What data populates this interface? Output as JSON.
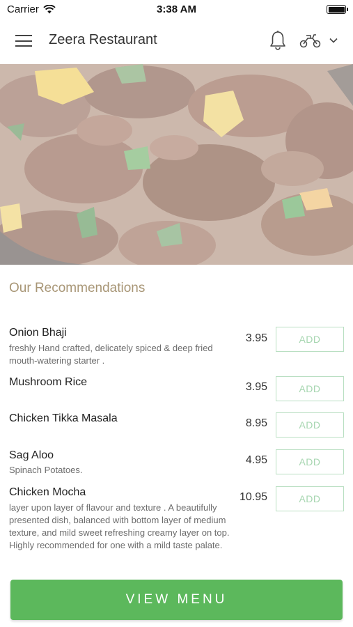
{
  "status_bar": {
    "carrier": "Carrier",
    "time": "3:38 AM"
  },
  "header": {
    "title": "Zeera Restaurant",
    "icons": [
      "menu-icon",
      "bell-icon",
      "delivery-scooter-icon",
      "chevron-down-icon"
    ]
  },
  "hero": {
    "image": "food-curry-image"
  },
  "recommendations": {
    "title": "Our Recommendations",
    "add_label": "ADD",
    "items": [
      {
        "name": "Onion Bhaji",
        "description": " freshly Hand crafted, delicately spiced & deep fried mouth-watering starter .",
        "price": "3.95"
      },
      {
        "name": "Mushroom Rice",
        "description": "",
        "price": "3.95"
      },
      {
        "name": "Chicken Tikka Masala",
        "description": "",
        "price": "8.95"
      },
      {
        "name": "Sag Aloo",
        "description": "Spinach Potatoes.",
        "price": "4.95"
      },
      {
        "name": "Chicken Mocha",
        "description": "layer upon layer of flavour and texture . A beautifully presented dish,  balanced with bottom layer of medium texture, and mild sweet refreshing creamy  layer on top. Highly recommended for one with a mild taste palate.",
        "price": "10.95"
      }
    ]
  },
  "footer": {
    "view_menu_label": "VIEW MENU"
  },
  "colors": {
    "accent_green": "#5cb85c",
    "section_title": "#a89676",
    "add_border": "#b9dfc2"
  }
}
